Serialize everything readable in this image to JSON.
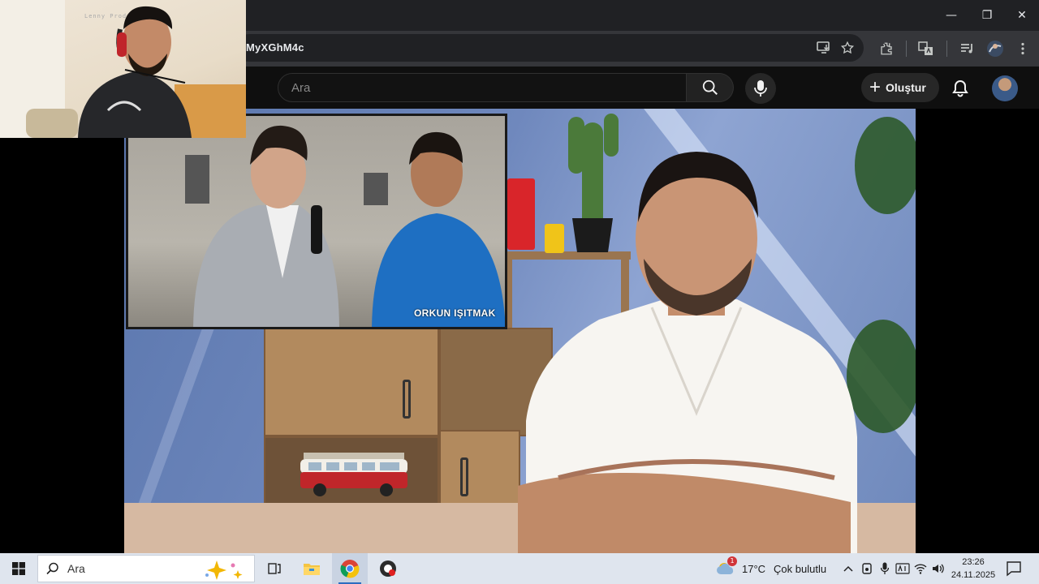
{
  "browser": {
    "url_fragment": "MyXGhM4c",
    "window_controls": {
      "minimize": "—",
      "restore": "❐",
      "close": "✕"
    }
  },
  "youtube": {
    "search_placeholder": "Ara",
    "create_label": "Oluştur",
    "create_plus": "+"
  },
  "video": {
    "inset_caption": "ORKUN IŞITMAK"
  },
  "webcam": {
    "watermark": "Lenny Producer.app"
  },
  "taskbar": {
    "search_label": "Ara",
    "weather": {
      "temp": "17°C",
      "condition": "Çok bulutlu",
      "badge": "1"
    },
    "clock": {
      "time": "23:26",
      "date": "24.11.2025"
    }
  },
  "colors": {
    "youtube_bg": "#0f0f0f",
    "chrome_toolbar": "#35363a",
    "taskbar_bg": "#dfe5ee",
    "accent_blue": "#2d6cc0"
  }
}
